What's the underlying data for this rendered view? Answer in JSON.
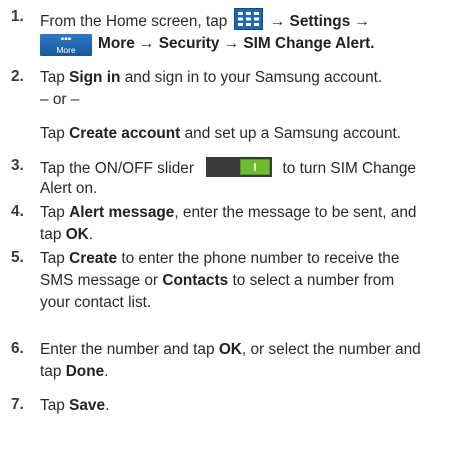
{
  "steps": [
    {
      "number": "1.",
      "line1_a": "From the Home screen, tap",
      "line1_b": "→ Settings →",
      "line2_more_icon_label": "More",
      "line2_text": "More → Security → SIM Change Alert."
    },
    {
      "number": "2.",
      "pre": "Tap",
      "bold": "Sign in",
      "post": "and sign in to your Samsung account.",
      "or": "– or –",
      "alt_pre": "Tap",
      "alt_bold": "Create account",
      "alt_post": "and set up a Samsung account."
    },
    {
      "number": "3.",
      "pre": "Tap the ON/OFF slider",
      "post": "to turn SIM Change",
      "line2": "Alert on."
    },
    {
      "number": "4.",
      "pre": "Tap",
      "bold": "Alert message",
      "post": ", enter the message to be sent, and",
      "line2_pre": "tap",
      "line2_bold": "OK",
      "line2_post": "."
    },
    {
      "number": "5.",
      "pre": "Tap",
      "bold": "Create",
      "post": "to enter the phone number to receive the",
      "line2_pre": "SMS message or",
      "line2_bold": "Contacts",
      "line2_post": "to select a number from",
      "line3": "your contact list."
    },
    {
      "number": "6.",
      "pre": "Enter the number and tap",
      "bold": "OK",
      "post": ", or select the number and",
      "line2_pre": "tap",
      "line2_bold": "Done",
      "line2_post": "."
    },
    {
      "number": "7.",
      "pre": "Tap",
      "bold": "Save",
      "post": "."
    }
  ],
  "icons": {
    "apps": "apps-grid-icon",
    "more": "more-icon",
    "slider": "on-off-slider-icon"
  },
  "colors": {
    "apps_icon": "#1f67b1",
    "more_icon": "#1f67b1",
    "slider_on": "#6fbb2f"
  }
}
